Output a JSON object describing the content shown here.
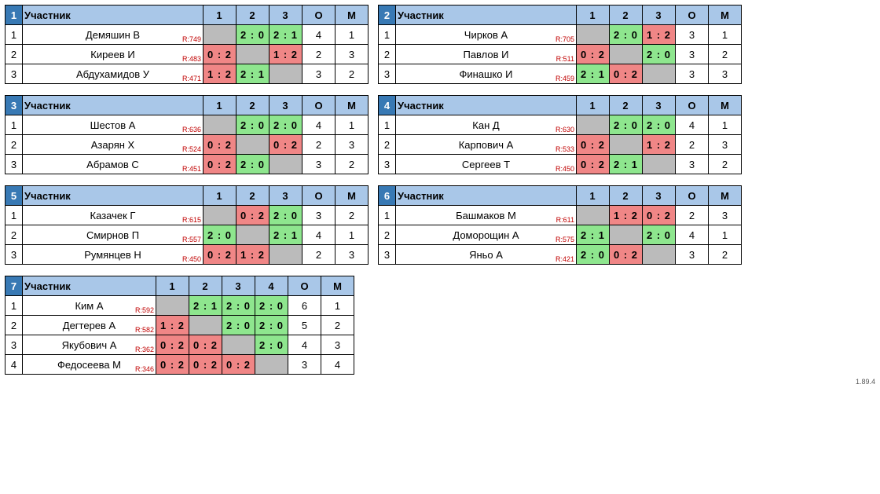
{
  "labels": {
    "participant": "Участник",
    "O": "О",
    "M": "М"
  },
  "version": "1.89.4",
  "groups": [
    {
      "num": 1,
      "cols": [
        "1",
        "2",
        "3"
      ],
      "rows": [
        {
          "n": 1,
          "name": "Демяшин В",
          "rating": "R:749",
          "cells": [
            null,
            "2 : 0",
            "2 : 1"
          ],
          "res": [
            null,
            "w",
            "w"
          ],
          "o": 4,
          "m": 1
        },
        {
          "n": 2,
          "name": "Киреев И",
          "rating": "R:483",
          "cells": [
            "0 : 2",
            null,
            "1 : 2"
          ],
          "res": [
            "l",
            null,
            "l"
          ],
          "o": 2,
          "m": 3
        },
        {
          "n": 3,
          "name": "Абдухамидов У",
          "rating": "R:471",
          "cells": [
            "1 : 2",
            "2 : 1",
            null
          ],
          "res": [
            "l",
            "w",
            null
          ],
          "o": 3,
          "m": 2
        }
      ]
    },
    {
      "num": 2,
      "cols": [
        "1",
        "2",
        "3"
      ],
      "rows": [
        {
          "n": 1,
          "name": "Чирков А",
          "rating": "R:705",
          "cells": [
            null,
            "2 : 0",
            "1 : 2"
          ],
          "res": [
            null,
            "w",
            "l"
          ],
          "o": 3,
          "m": 1
        },
        {
          "n": 2,
          "name": "Павлов И",
          "rating": "R:511",
          "cells": [
            "0 : 2",
            null,
            "2 : 0"
          ],
          "res": [
            "l",
            null,
            "w"
          ],
          "o": 3,
          "m": 2
        },
        {
          "n": 3,
          "name": "Финашко И",
          "rating": "R:459",
          "cells": [
            "2 : 1",
            "0 : 2",
            null
          ],
          "res": [
            "w",
            "l",
            null
          ],
          "o": 3,
          "m": 3
        }
      ]
    },
    {
      "num": 3,
      "cols": [
        "1",
        "2",
        "3"
      ],
      "rows": [
        {
          "n": 1,
          "name": "Шестов А",
          "rating": "R:636",
          "cells": [
            null,
            "2 : 0",
            "2 : 0"
          ],
          "res": [
            null,
            "w",
            "w"
          ],
          "o": 4,
          "m": 1
        },
        {
          "n": 2,
          "name": "Азарян Х",
          "rating": "R:524",
          "cells": [
            "0 : 2",
            null,
            "0 : 2"
          ],
          "res": [
            "l",
            null,
            "l"
          ],
          "o": 2,
          "m": 3
        },
        {
          "n": 3,
          "name": "Абрамов С",
          "rating": "R:451",
          "cells": [
            "0 : 2",
            "2 : 0",
            null
          ],
          "res": [
            "l",
            "w",
            null
          ],
          "o": 3,
          "m": 2
        }
      ]
    },
    {
      "num": 4,
      "cols": [
        "1",
        "2",
        "3"
      ],
      "rows": [
        {
          "n": 1,
          "name": "Кан Д",
          "rating": "R:630",
          "cells": [
            null,
            "2 : 0",
            "2 : 0"
          ],
          "res": [
            null,
            "w",
            "w"
          ],
          "o": 4,
          "m": 1
        },
        {
          "n": 2,
          "name": "Карпович А",
          "rating": "R:533",
          "cells": [
            "0 : 2",
            null,
            "1 : 2"
          ],
          "res": [
            "l",
            null,
            "l"
          ],
          "o": 2,
          "m": 3
        },
        {
          "n": 3,
          "name": "Сергеев Т",
          "rating": "R:450",
          "cells": [
            "0 : 2",
            "2 : 1",
            null
          ],
          "res": [
            "l",
            "w",
            null
          ],
          "o": 3,
          "m": 2
        }
      ]
    },
    {
      "num": 5,
      "cols": [
        "1",
        "2",
        "3"
      ],
      "rows": [
        {
          "n": 1,
          "name": "Казачек Г",
          "rating": "R:615",
          "cells": [
            null,
            "0 : 2",
            "2 : 0"
          ],
          "res": [
            null,
            "l",
            "w"
          ],
          "o": 3,
          "m": 2
        },
        {
          "n": 2,
          "name": "Смирнов П",
          "rating": "R:557",
          "cells": [
            "2 : 0",
            null,
            "2 : 1"
          ],
          "res": [
            "w",
            null,
            "w"
          ],
          "o": 4,
          "m": 1
        },
        {
          "n": 3,
          "name": "Румянцев Н",
          "rating": "R:450",
          "cells": [
            "0 : 2",
            "1 : 2",
            null
          ],
          "res": [
            "l",
            "l",
            null
          ],
          "o": 2,
          "m": 3
        }
      ]
    },
    {
      "num": 6,
      "cols": [
        "1",
        "2",
        "3"
      ],
      "rows": [
        {
          "n": 1,
          "name": "Башмаков М",
          "rating": "R:611",
          "cells": [
            null,
            "1 : 2",
            "0 : 2"
          ],
          "res": [
            null,
            "l",
            "l"
          ],
          "o": 2,
          "m": 3
        },
        {
          "n": 2,
          "name": "Доморощин А",
          "rating": "R:575",
          "cells": [
            "2 : 1",
            null,
            "2 : 0"
          ],
          "res": [
            "w",
            null,
            "w"
          ],
          "o": 4,
          "m": 1
        },
        {
          "n": 3,
          "name": "Яньо А",
          "rating": "R:421",
          "cells": [
            "2 : 0",
            "0 : 2",
            null
          ],
          "res": [
            "w",
            "l",
            null
          ],
          "o": 3,
          "m": 2
        }
      ]
    },
    {
      "num": 7,
      "cols": [
        "1",
        "2",
        "3",
        "4"
      ],
      "rows": [
        {
          "n": 1,
          "name": "Ким А",
          "rating": "R:592",
          "cells": [
            null,
            "2 : 1",
            "2 : 0",
            "2 : 0"
          ],
          "res": [
            null,
            "w",
            "w",
            "w"
          ],
          "o": 6,
          "m": 1
        },
        {
          "n": 2,
          "name": "Дегтерев А",
          "rating": "R:582",
          "cells": [
            "1 : 2",
            null,
            "2 : 0",
            "2 : 0"
          ],
          "res": [
            "l",
            null,
            "w",
            "w"
          ],
          "o": 5,
          "m": 2
        },
        {
          "n": 3,
          "name": "Якубович А",
          "rating": "R:362",
          "cells": [
            "0 : 2",
            "0 : 2",
            null,
            "2 : 0"
          ],
          "res": [
            "l",
            "l",
            null,
            "w"
          ],
          "o": 4,
          "m": 3
        },
        {
          "n": 4,
          "name": "Федосеева М",
          "rating": "R:346",
          "cells": [
            "0 : 2",
            "0 : 2",
            "0 : 2",
            null
          ],
          "res": [
            "l",
            "l",
            "l",
            null
          ],
          "o": 3,
          "m": 4
        }
      ]
    }
  ]
}
